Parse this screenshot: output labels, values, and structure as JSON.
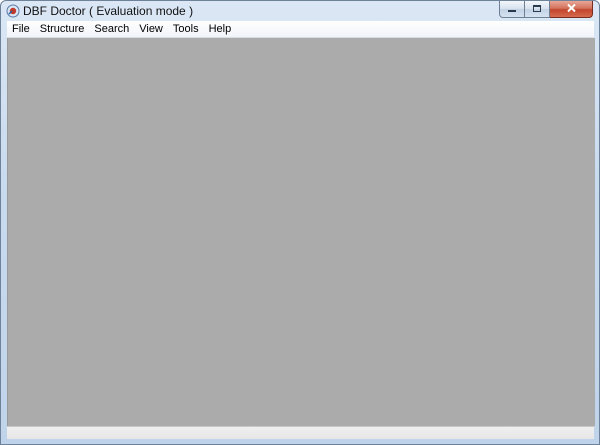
{
  "window": {
    "title": "DBF Doctor ( Evaluation mode )",
    "app_icon": "dbf-doctor-app-icon",
    "caption_buttons": [
      {
        "name": "minimize",
        "icon": "minimize-icon"
      },
      {
        "name": "maximize",
        "icon": "maximize-icon"
      },
      {
        "name": "close",
        "icon": "close-icon"
      }
    ]
  },
  "menu": {
    "items": [
      "File",
      "Structure",
      "Search",
      "View",
      "Tools",
      "Help"
    ]
  },
  "colors": {
    "client_area": "#ababab",
    "frame": "#c9dbef",
    "close_button": "#c2452c"
  }
}
